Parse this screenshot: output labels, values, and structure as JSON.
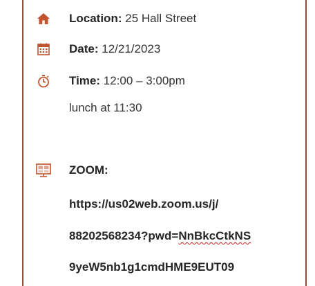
{
  "event": {
    "location_label": "Location:",
    "location_value": "25 Hall Street",
    "date_label": "Date:",
    "date_value": "12/21/2023",
    "time_label": "Time:",
    "time_value": "12:00 – 3:00pm",
    "time_note": "lunch at 11:30",
    "zoom_label": "ZOOM:",
    "zoom_url_line1": "https://us02web.zoom.us/j/",
    "zoom_url_line2_prefix": "88202568234?pwd=",
    "zoom_url_line2_flagged": "NnBkcCtkNS",
    "zoom_url_line3": "9yeW5nb1g1cmdHME9EUT09"
  },
  "icons": {
    "location": "home-icon",
    "date": "calendar-icon",
    "time": "stopwatch-icon",
    "zoom": "presentation-screen-icon"
  },
  "colors": {
    "accent": "#c0532d",
    "border": "#8a5236",
    "spellcheck": "#d42020"
  }
}
